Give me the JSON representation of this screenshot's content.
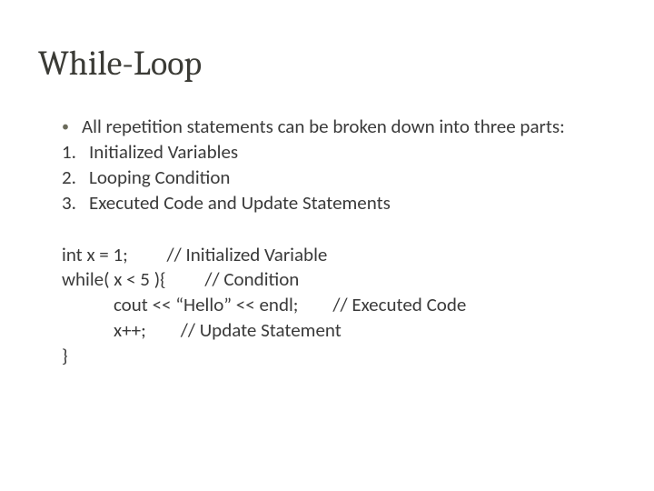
{
  "title": "While-Loop",
  "intro": "All repetition statements can be broken down into three parts:",
  "parts": [
    {
      "n": "1.",
      "t": "Initialized Variables"
    },
    {
      "n": "2.",
      "t": "Looping Condition"
    },
    {
      "n": "3.",
      "t": "Executed Code and Update Statements"
    }
  ],
  "code": {
    "l1": "int x = 1;         // Initialized Variable",
    "l2": "while( x < 5 ){         // Condition",
    "l3": "            cout << “Hello” << endl;        // Executed Code",
    "l4": "            x++;        // Update Statement",
    "l5": "}"
  }
}
